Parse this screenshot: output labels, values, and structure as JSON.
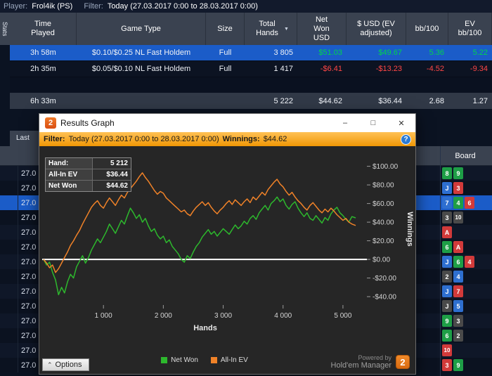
{
  "top_bar": {
    "player_label": "Player:",
    "player_value": "Frol4ik (PS)",
    "filter_label": "Filter:",
    "filter_value": "Today (27.03.2017 0:00 to 28.03.2017 0:00)"
  },
  "stats_tab": "Stats",
  "last_tab": "Last",
  "results_table": {
    "headers": [
      "Time Played",
      "Game Type",
      "Size",
      "Total Hands",
      "Net Won USD",
      "$ USD (EV adjusted)",
      "bb/100",
      "EV bb/100"
    ],
    "sort_column": "Total Hands",
    "rows": [
      {
        "time": "3h 58m",
        "game": "$0.10/$0.25 NL Fast Holdem",
        "size": "Full",
        "hands": "3 805",
        "net_won": "$51.03",
        "ev_usd": "$49.67",
        "bb100": "5.36",
        "ev_bb100": "5.22",
        "selected": true
      },
      {
        "time": "2h 35m",
        "game": "$0.05/$0.10 NL Fast Holdem",
        "size": "Full",
        "hands": "1 417",
        "net_won": "-$6.41",
        "ev_usd": "-$13.23",
        "bb100": "-4.52",
        "ev_bb100": "-9.34",
        "selected": false
      }
    ],
    "total_row": {
      "time": "6h 33m",
      "game": "",
      "size": "",
      "hands": "5 222",
      "net_won": "$44.62",
      "ev_usd": "$36.44",
      "bb100": "2.68",
      "ev_bb100": "1.27"
    }
  },
  "hands_table": {
    "board_header": "Board",
    "date_fragment": "27.0",
    "rows": [
      {
        "cards": [
          [
            "8",
            "c"
          ],
          [
            "9",
            "c"
          ]
        ],
        "selected": false
      },
      {
        "cards": [
          [
            "J",
            "d"
          ],
          [
            "3",
            "h"
          ]
        ],
        "selected": false
      },
      {
        "cards": [
          [
            "7",
            "d"
          ],
          [
            "4",
            "c"
          ],
          [
            "6",
            "h"
          ]
        ],
        "selected": true
      },
      {
        "cards": [
          [
            "3",
            "s"
          ],
          [
            "10",
            "s"
          ]
        ],
        "selected": false
      },
      {
        "cards": [
          [
            "A",
            "h"
          ]
        ],
        "selected": false
      },
      {
        "cards": [
          [
            "6",
            "c"
          ],
          [
            "A",
            "h"
          ]
        ],
        "selected": false
      },
      {
        "cards": [
          [
            "J",
            "d"
          ],
          [
            "6",
            "c"
          ],
          [
            "4",
            "h"
          ]
        ],
        "selected": false
      },
      {
        "cards": [
          [
            "2",
            "s"
          ],
          [
            "4",
            "d"
          ]
        ],
        "selected": false
      },
      {
        "cards": [
          [
            "J",
            "d"
          ],
          [
            "7",
            "h"
          ]
        ],
        "selected": false
      },
      {
        "cards": [
          [
            "J",
            "s"
          ],
          [
            "5",
            "d"
          ]
        ],
        "selected": false
      },
      {
        "cards": [
          [
            "9",
            "c"
          ],
          [
            "3",
            "s"
          ]
        ],
        "selected": false
      },
      {
        "cards": [
          [
            "6",
            "c"
          ],
          [
            "2",
            "s"
          ]
        ],
        "selected": false
      },
      {
        "cards": [
          [
            "10",
            "h"
          ]
        ],
        "selected": false
      },
      {
        "cards": [
          [
            "3",
            "h"
          ],
          [
            "9",
            "c"
          ]
        ],
        "selected": false
      }
    ]
  },
  "graph_window": {
    "title": "Results Graph",
    "icon_text": "2",
    "filter_bar": {
      "filter_label": "Filter:",
      "filter_value": "Today (27.03.2017 0:00 to 28.03.2017 0:00)",
      "winnings_label": "Winnings:",
      "winnings_value": "$44.62"
    },
    "info_box": {
      "rows": [
        [
          "Hand:",
          "5 212"
        ],
        [
          "All-In EV",
          "$36.44"
        ],
        [
          "Net Won",
          "$44.62"
        ]
      ]
    },
    "options_label": "Options",
    "powered_by": {
      "line1": "Powered by",
      "line2": "Hold'em Manager",
      "logo": "2"
    }
  },
  "icons": {
    "minimize": "–",
    "maximize": "□",
    "close": "✕",
    "help": "?",
    "options_chevron": "⌃",
    "sort_desc": "▼"
  },
  "colors": {
    "positive": "#00d44c",
    "negative": "#ff4646",
    "selection": "#1b5cc8",
    "filter_bar_orange": "#f09705",
    "suits": {
      "c": "#1e9e46",
      "d": "#2e6fd0",
      "h": "#d23a3a",
      "s": "#4a4a4a"
    }
  },
  "chart_data": {
    "type": "line",
    "title": "",
    "xlabel": "Hands",
    "ylabel": "Winnings",
    "xlim": [
      0,
      5400
    ],
    "ylim": [
      -52,
      108
    ],
    "grid": false,
    "zero_line": true,
    "legend_position": "bottom-center",
    "x_ticks": [
      1000,
      2000,
      3000,
      4000,
      5000
    ],
    "x_tick_labels": [
      "1 000",
      "2 000",
      "3 000",
      "4 000",
      "5 000"
    ],
    "y_ticks": [
      100,
      80,
      60,
      40,
      20,
      0,
      -20,
      -40
    ],
    "y_tick_labels": [
      "$100.00",
      "$80.00",
      "$60.00",
      "$40.00",
      "$20.00",
      "$0.00",
      "-$20.00",
      "-$40.00"
    ],
    "legend": [
      {
        "name": "Net Won",
        "color": "#2db82d"
      },
      {
        "name": "All-In EV",
        "color": "#f08228"
      }
    ],
    "series": [
      {
        "name": "Net Won",
        "color": "#2db82d",
        "final_value": 44.62,
        "points": [
          [
            0,
            0
          ],
          [
            50,
            -6
          ],
          [
            100,
            -3
          ],
          [
            150,
            -14
          ],
          [
            200,
            -22
          ],
          [
            250,
            -38
          ],
          [
            300,
            -30
          ],
          [
            350,
            -36
          ],
          [
            400,
            -24
          ],
          [
            450,
            -16
          ],
          [
            500,
            -20
          ],
          [
            550,
            -8
          ],
          [
            600,
            -2
          ],
          [
            650,
            4
          ],
          [
            700,
            -4
          ],
          [
            750,
            2
          ],
          [
            800,
            10
          ],
          [
            850,
            16
          ],
          [
            900,
            22
          ],
          [
            950,
            18
          ],
          [
            1000,
            24
          ],
          [
            1050,
            30
          ],
          [
            1100,
            38
          ],
          [
            1150,
            33
          ],
          [
            1200,
            28
          ],
          [
            1250,
            35
          ],
          [
            1300,
            42
          ],
          [
            1350,
            38
          ],
          [
            1400,
            47
          ],
          [
            1450,
            55
          ],
          [
            1500,
            50
          ],
          [
            1550,
            44
          ],
          [
            1600,
            48
          ],
          [
            1650,
            40
          ],
          [
            1700,
            44
          ],
          [
            1750,
            36
          ],
          [
            1800,
            30
          ],
          [
            1850,
            33
          ],
          [
            1900,
            26
          ],
          [
            1950,
            22
          ],
          [
            2000,
            25
          ],
          [
            2050,
            18
          ],
          [
            2100,
            21
          ],
          [
            2150,
            14
          ],
          [
            2200,
            10
          ],
          [
            2250,
            6
          ],
          [
            2300,
            0
          ],
          [
            2350,
            -3
          ],
          [
            2400,
            4
          ],
          [
            2450,
            1
          ],
          [
            2500,
            8
          ],
          [
            2550,
            14
          ],
          [
            2600,
            18
          ],
          [
            2650,
            24
          ],
          [
            2700,
            28
          ],
          [
            2750,
            32
          ],
          [
            2800,
            27
          ],
          [
            2850,
            30
          ],
          [
            2900,
            25
          ],
          [
            2950,
            29
          ],
          [
            3000,
            33
          ],
          [
            3050,
            30
          ],
          [
            3100,
            27
          ],
          [
            3150,
            32
          ],
          [
            3200,
            37
          ],
          [
            3250,
            33
          ],
          [
            3300,
            36
          ],
          [
            3350,
            41
          ],
          [
            3400,
            38
          ],
          [
            3450,
            44
          ],
          [
            3500,
            47
          ],
          [
            3550,
            43
          ],
          [
            3600,
            50
          ],
          [
            3650,
            54
          ],
          [
            3700,
            58
          ],
          [
            3750,
            53
          ],
          [
            3800,
            60
          ],
          [
            3850,
            63
          ],
          [
            3900,
            67
          ],
          [
            3950,
            62
          ],
          [
            4000,
            65
          ],
          [
            4050,
            58
          ],
          [
            4100,
            54
          ],
          [
            4150,
            59
          ],
          [
            4200,
            62
          ],
          [
            4250,
            55
          ],
          [
            4300,
            50
          ],
          [
            4350,
            46
          ],
          [
            4400,
            50
          ],
          [
            4450,
            44
          ],
          [
            4500,
            42
          ],
          [
            4550,
            47
          ],
          [
            4600,
            43
          ],
          [
            4650,
            39
          ],
          [
            4700,
            45
          ],
          [
            4750,
            42
          ],
          [
            4800,
            49
          ],
          [
            4850,
            53
          ],
          [
            4900,
            56
          ],
          [
            4950,
            50
          ],
          [
            5000,
            47
          ],
          [
            5050,
            43
          ],
          [
            5100,
            40
          ],
          [
            5150,
            46
          ],
          [
            5212,
            44.62
          ]
        ]
      },
      {
        "name": "All-In EV",
        "color": "#f08228",
        "final_value": 36.44,
        "points": [
          [
            0,
            0
          ],
          [
            50,
            -4
          ],
          [
            100,
            -9
          ],
          [
            150,
            -6
          ],
          [
            200,
            -14
          ],
          [
            250,
            -10
          ],
          [
            300,
            -4
          ],
          [
            350,
            2
          ],
          [
            400,
            8
          ],
          [
            450,
            15
          ],
          [
            500,
            20
          ],
          [
            550,
            26
          ],
          [
            600,
            31
          ],
          [
            650,
            38
          ],
          [
            700,
            44
          ],
          [
            750,
            50
          ],
          [
            800,
            56
          ],
          [
            850,
            60
          ],
          [
            900,
            63
          ],
          [
            950,
            58
          ],
          [
            1000,
            55
          ],
          [
            1050,
            61
          ],
          [
            1100,
            66
          ],
          [
            1150,
            62
          ],
          [
            1200,
            58
          ],
          [
            1250,
            64
          ],
          [
            1300,
            69
          ],
          [
            1350,
            66
          ],
          [
            1400,
            72
          ],
          [
            1450,
            76
          ],
          [
            1500,
            80
          ],
          [
            1550,
            84
          ],
          [
            1600,
            89
          ],
          [
            1650,
            93
          ],
          [
            1700,
            88
          ],
          [
            1750,
            84
          ],
          [
            1800,
            79
          ],
          [
            1850,
            74
          ],
          [
            1900,
            70
          ],
          [
            1950,
            73
          ],
          [
            2000,
            71
          ],
          [
            2050,
            66
          ],
          [
            2100,
            63
          ],
          [
            2150,
            60
          ],
          [
            2200,
            57
          ],
          [
            2250,
            54
          ],
          [
            2300,
            51
          ],
          [
            2350,
            53
          ],
          [
            2400,
            49
          ],
          [
            2450,
            47
          ],
          [
            2500,
            52
          ],
          [
            2550,
            56
          ],
          [
            2600,
            59
          ],
          [
            2650,
            62
          ],
          [
            2700,
            58
          ],
          [
            2750,
            61
          ],
          [
            2800,
            56
          ],
          [
            2850,
            52
          ],
          [
            2900,
            49
          ],
          [
            2950,
            53
          ],
          [
            3000,
            56
          ],
          [
            3050,
            60
          ],
          [
            3100,
            63
          ],
          [
            3150,
            59
          ],
          [
            3200,
            64
          ],
          [
            3250,
            61
          ],
          [
            3300,
            58
          ],
          [
            3350,
            62
          ],
          [
            3400,
            65
          ],
          [
            3450,
            61
          ],
          [
            3500,
            67
          ],
          [
            3550,
            64
          ],
          [
            3600,
            68
          ],
          [
            3650,
            72
          ],
          [
            3700,
            69
          ],
          [
            3750,
            75
          ],
          [
            3800,
            79
          ],
          [
            3850,
            83
          ],
          [
            3900,
            86
          ],
          [
            3950,
            81
          ],
          [
            4000,
            78
          ],
          [
            4050,
            73
          ],
          [
            4100,
            69
          ],
          [
            4150,
            72
          ],
          [
            4200,
            67
          ],
          [
            4250,
            63
          ],
          [
            4300,
            60
          ],
          [
            4350,
            56
          ],
          [
            4400,
            53
          ],
          [
            4450,
            58
          ],
          [
            4500,
            61
          ],
          [
            4550,
            57
          ],
          [
            4600,
            53
          ],
          [
            4650,
            50
          ],
          [
            4700,
            54
          ],
          [
            4750,
            51
          ],
          [
            4800,
            55
          ],
          [
            4850,
            52
          ],
          [
            4900,
            48
          ],
          [
            4950,
            45
          ],
          [
            5000,
            42
          ],
          [
            5050,
            44
          ],
          [
            5100,
            40
          ],
          [
            5150,
            38
          ],
          [
            5212,
            36.44
          ]
        ]
      }
    ]
  }
}
